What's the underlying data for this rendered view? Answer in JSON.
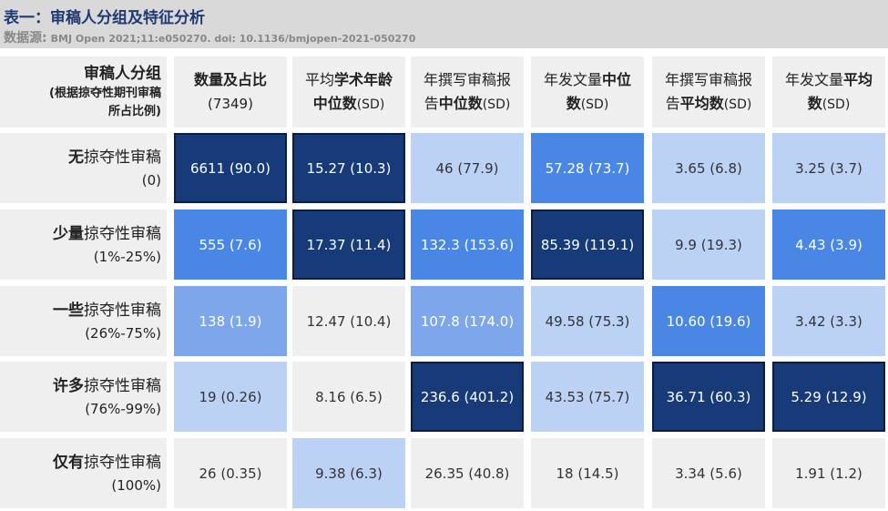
{
  "title": "表一：审稿人分组及特征分析",
  "source_label": "数据源:",
  "source_text": "BMJ Open 2021;11:e050270. doi: 10.1136/bmjopen-2021-050270",
  "corner": {
    "line1": "审稿人分组",
    "line2": "(根据掠夺性期刊审稿",
    "line3": "所占比例)"
  },
  "columns": [
    {
      "parts": [
        {
          "t": "数量及占比",
          "b": true
        }
      ],
      "sub": "(7349)"
    },
    {
      "parts": [
        {
          "t": "平均",
          "b": false
        },
        {
          "t": "学术年龄",
          "b": true
        }
      ],
      "line2": [
        {
          "t": "中位数",
          "b": true
        },
        {
          "t": "(SD)",
          "b": false
        }
      ]
    },
    {
      "parts": [
        {
          "t": "年撰写审稿报",
          "b": false
        }
      ],
      "line2": [
        {
          "t": "告",
          "b": false
        },
        {
          "t": "中位数",
          "b": true
        },
        {
          "t": "(SD)",
          "b": false
        }
      ]
    },
    {
      "parts": [
        {
          "t": "年发文量",
          "b": false
        },
        {
          "t": "中位",
          "b": true
        }
      ],
      "line2": [
        {
          "t": "数",
          "b": true
        },
        {
          "t": "(SD)",
          "b": false
        }
      ]
    },
    {
      "parts": [
        {
          "t": "年撰写审稿报",
          "b": false
        }
      ],
      "line2": [
        {
          "t": "告",
          "b": false
        },
        {
          "t": "平均数",
          "b": true
        },
        {
          "t": "(SD)",
          "b": false
        }
      ]
    },
    {
      "parts": [
        {
          "t": "年发文量",
          "b": false
        },
        {
          "t": "平均",
          "b": true
        }
      ],
      "line2": [
        {
          "t": "数",
          "b": true
        },
        {
          "t": "(SD)",
          "b": false
        }
      ]
    }
  ],
  "rows": [
    {
      "bold": "无",
      "rest": "掠夺性审稿",
      "range": "(0)"
    },
    {
      "bold": "少量",
      "rest": "掠夺性审稿",
      "range": "(1%-25%)"
    },
    {
      "bold": "一些",
      "rest": "掠夺性审稿",
      "range": "(26%-75%)"
    },
    {
      "bold": "许多",
      "rest": "掠夺性审稿",
      "range": "(76%-99%)"
    },
    {
      "bold": "仅有",
      "rest": "掠夺性审稿",
      "range": "(100%)"
    }
  ],
  "chart_data": {
    "type": "table",
    "title": "表一：审稿人分组及特征分析",
    "cells": [
      [
        "6611 (90.0)",
        "15.27 (10.3)",
        "46 (77.9)",
        "57.28 (73.7)",
        "3.65 (6.8)",
        "3.25 (3.7)"
      ],
      [
        "555 (7.6)",
        "17.37 (11.4)",
        "132.3 (153.6)",
        "85.39 (119.1)",
        "9.9 (19.3)",
        "4.43 (3.9)"
      ],
      [
        "138 (1.9)",
        "12.47 (10.4)",
        "107.8 (174.0)",
        "49.58 (75.3)",
        "10.60 (19.6)",
        "3.42 (3.3)"
      ],
      [
        "19 (0.26)",
        "8.16 (6.5)",
        "236.6 (401.2)",
        "43.53 (75.7)",
        "36.71 (60.3)",
        "5.29 (12.9)"
      ],
      [
        "26 (0.35)",
        "9.38 (6.3)",
        "26.35 (40.8)",
        "18 (14.5)",
        "3.34 (5.6)",
        "1.91 (1.2)"
      ]
    ],
    "shade_levels": [
      [
        4,
        4,
        1,
        3,
        1,
        1
      ],
      [
        3,
        4,
        3,
        4,
        1,
        3
      ],
      [
        2,
        0,
        2,
        1,
        3,
        1
      ],
      [
        1,
        0,
        4,
        1,
        4,
        4
      ],
      [
        0,
        1,
        0,
        0,
        0,
        0
      ]
    ],
    "shade_colors": [
      "#efefef",
      "#bcd2f5",
      "#7da7ea",
      "#4a86e4",
      "#173a78"
    ]
  }
}
